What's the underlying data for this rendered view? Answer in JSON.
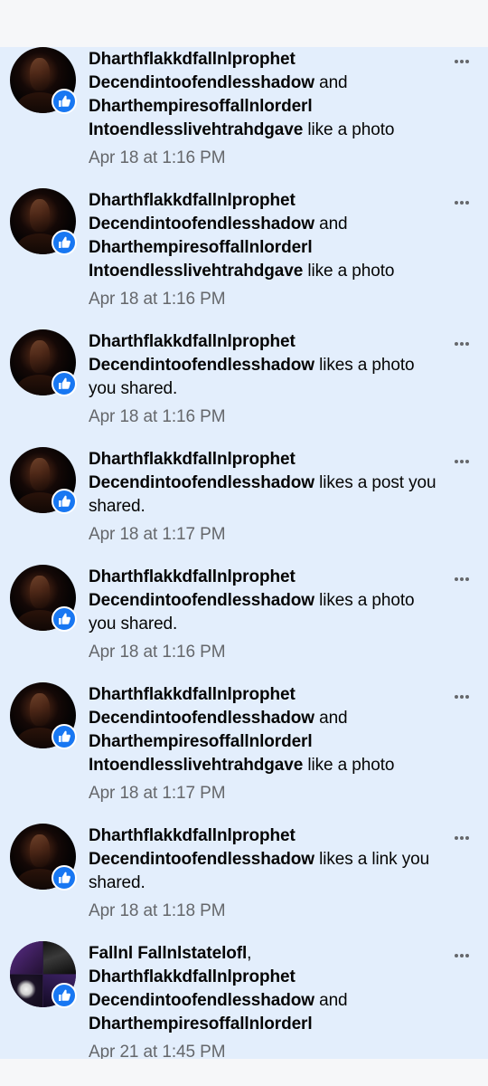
{
  "notifications": [
    {
      "actor1": "Dharthflakkdfallnlprophet Decendintoofendlesshadow",
      "joiner": " and ",
      "actor2": "Dharthempiresoffallnlorderl Intoendlesslivehtrahdgave",
      "action": " like a photo",
      "time": "Apr 18 at 1:16 PM",
      "avatar": "dark-portrait",
      "badge_icon": "thumbs-up-icon",
      "menu_icon": "more-options-icon"
    },
    {
      "actor1": "Dharthflakkdfallnlprophet Decendintoofendlesshadow",
      "joiner": " and ",
      "actor2": "Dharthempiresoffallnlorderl Intoendlesslivehtrahdgave",
      "action": " like a photo",
      "time": "Apr 18 at 1:16 PM",
      "avatar": "dark-portrait",
      "badge_icon": "thumbs-up-icon",
      "menu_icon": "more-options-icon"
    },
    {
      "actor1": "Dharthflakkdfallnlprophet Decendintoofendlesshadow",
      "action": " likes a photo you shared.",
      "time": "Apr 18 at 1:16 PM",
      "avatar": "dark-portrait",
      "badge_icon": "thumbs-up-icon",
      "menu_icon": "more-options-icon"
    },
    {
      "actor1": "Dharthflakkdfallnlprophet Decendintoofendlesshadow",
      "action": " likes a post you shared.",
      "time": "Apr 18 at 1:17 PM",
      "avatar": "dark-portrait",
      "badge_icon": "thumbs-up-icon",
      "menu_icon": "more-options-icon"
    },
    {
      "actor1": "Dharthflakkdfallnlprophet Decendintoofendlesshadow",
      "action": " likes a photo you shared.",
      "time": "Apr 18 at 1:16 PM",
      "avatar": "dark-portrait",
      "badge_icon": "thumbs-up-icon",
      "menu_icon": "more-options-icon"
    },
    {
      "actor1": "Dharthflakkdfallnlprophet Decendintoofendlesshadow",
      "joiner": " and ",
      "actor2": "Dharthempiresoffallnlorderl Intoendlesslivehtrahdgave",
      "action": " like a photo",
      "time": "Apr 18 at 1:17 PM",
      "avatar": "dark-portrait",
      "badge_icon": "thumbs-up-icon",
      "menu_icon": "more-options-icon"
    },
    {
      "actor1": "Dharthflakkdfallnlprophet Decendintoofendlesshadow",
      "action": " likes a link you shared.",
      "time": "Apr 18 at 1:18 PM",
      "avatar": "dark-portrait",
      "badge_icon": "thumbs-up-icon",
      "menu_icon": "more-options-icon"
    },
    {
      "actor0": "Fallnl Fallnlstatelofl",
      "sep0": ",",
      "actor1": "Dharthflakkdfallnlprophet Decendintoofendlesshadow",
      "joiner": " and ",
      "actor2": "Dharthempiresoffallnlorderl",
      "time": "Apr 21 at 1:45 PM",
      "avatar": "group-collage",
      "badge_icon": "thumbs-up-icon",
      "menu_icon": "more-options-icon"
    }
  ],
  "colors": {
    "unread_background": "#e3eefc",
    "like_badge": "#1877f2",
    "timestamp": "#65676b",
    "name_text": "#050505"
  }
}
